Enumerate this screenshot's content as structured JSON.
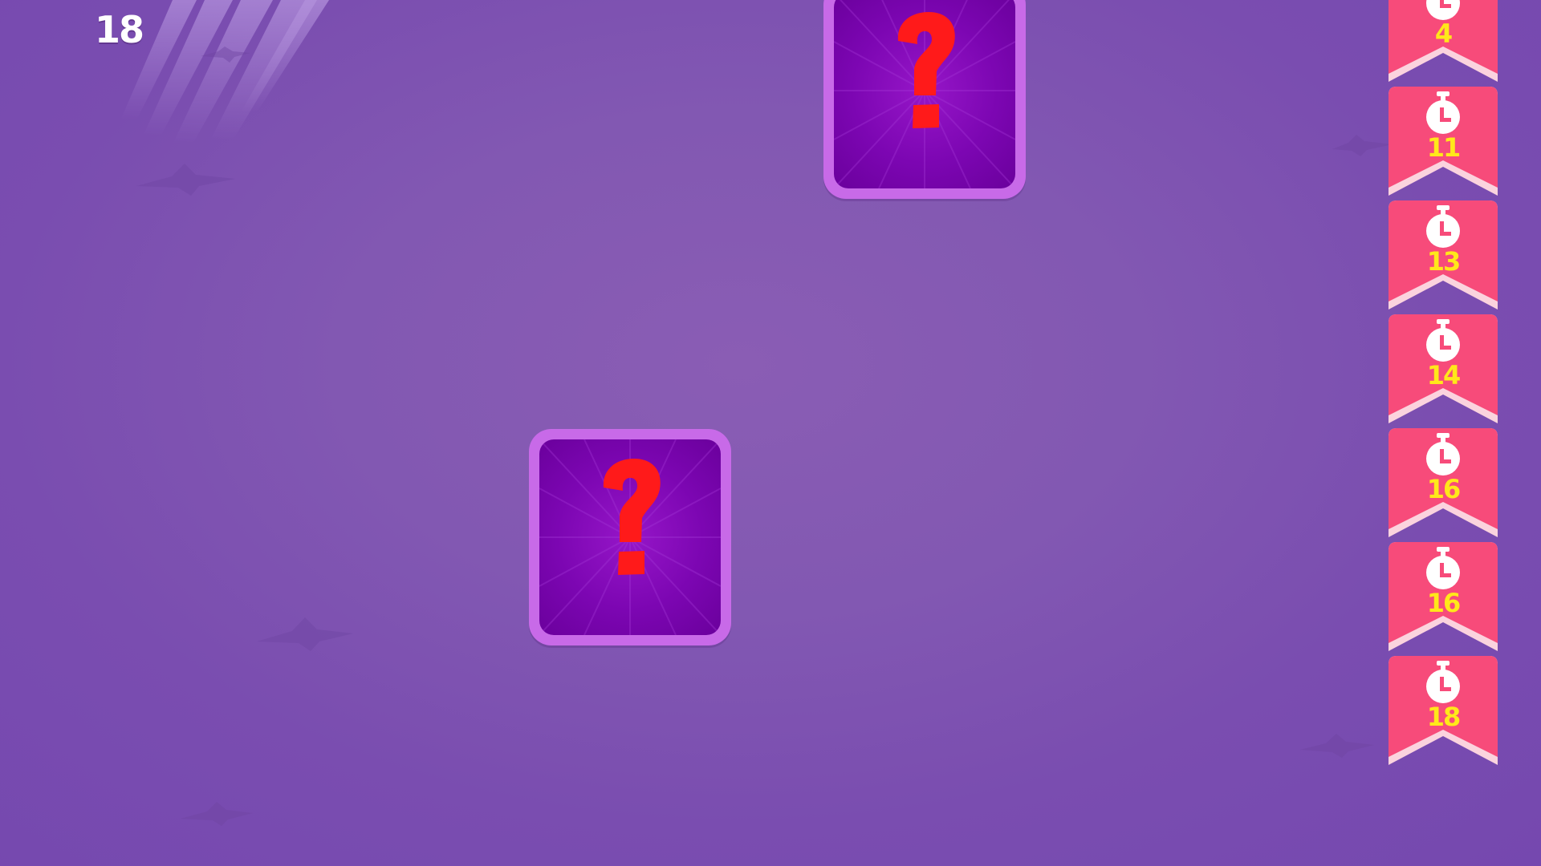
{
  "hud": {
    "timer_value": "18"
  },
  "cards": [
    {
      "face": "?",
      "state": "face-down"
    },
    {
      "face": "?",
      "state": "face-down"
    }
  ],
  "reward_column": {
    "items": [
      {
        "icon": "stopwatch-icon",
        "value": "4"
      },
      {
        "icon": "stopwatch-icon",
        "value": "11"
      },
      {
        "icon": "stopwatch-icon",
        "value": "13"
      },
      {
        "icon": "stopwatch-icon",
        "value": "14"
      },
      {
        "icon": "stopwatch-icon",
        "value": "16"
      },
      {
        "icon": "stopwatch-icon",
        "value": "16"
      },
      {
        "icon": "stopwatch-icon",
        "value": "18"
      }
    ]
  },
  "colors": {
    "background": "#7f53b2",
    "card_border": "#c86ae8",
    "card_face": "#7c06b2",
    "question_mark": "#ff1a1a",
    "ribbon": "#f74b7a",
    "ribbon_number": "#ffe81a"
  }
}
